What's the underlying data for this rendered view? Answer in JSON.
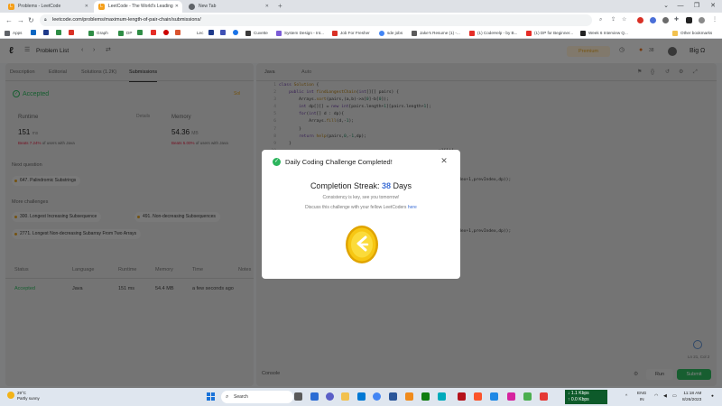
{
  "browser": {
    "tabs": [
      {
        "title": "Problems - LeetCode",
        "active": false
      },
      {
        "title": "LeetCode - The World's Leading",
        "active": true
      },
      {
        "title": "New Tab",
        "active": false
      }
    ],
    "url": "leetcode.com/problems/maximum-length-of-pair-chain/submissions/",
    "bookmarks": [
      "Apps",
      "Graph",
      "DP",
      "Lec",
      "Cuvette",
      "System Design - Int...",
      "Job For Fresher",
      "sde jobs",
      "Jake's Resume (1) -...",
      "(1) CodeHelp - by B...",
      "(1) DP for Beginner...",
      "Week 6 Interview Q...",
      "Other bookmarks"
    ]
  },
  "lc_header": {
    "problem_list": "Problem List",
    "premium": "Premium",
    "streak_count": "38",
    "username": "Big Ω"
  },
  "left": {
    "tabs": [
      "Description",
      "Editorial",
      "Solutions (1.2K)",
      "Submissions"
    ],
    "status": "Accepted",
    "solution_btn": "Sol",
    "runtime_label": "Runtime",
    "runtime_value": "151",
    "runtime_unit": "ms",
    "runtime_beats_pct": "Beats 7.24%",
    "runtime_beats_rest": "of users with Java",
    "details": "Details",
    "memory_label": "Memory",
    "memory_value": "54.36",
    "memory_unit": "MB",
    "memory_beats_pct": "Beats 5.00%",
    "memory_beats_rest": "of users with Java",
    "next_question_label": "Next question",
    "next_question": "647. Palindromic Substrings",
    "more_challenges_label": "More challenges",
    "challenges": [
      "300. Longest Increasing Subsequence",
      "491. Non-decreasing Subsequences",
      "2771. Longest Non-decreasing Subarray From Two Arrays"
    ],
    "table_headers": [
      "Status",
      "Language",
      "Runtime",
      "Memory",
      "Time",
      "Notes"
    ],
    "row": {
      "status": "Accepted",
      "language": "Java",
      "runtime": "151 ms",
      "memory": "54.4 MB",
      "time": "a few seconds ago"
    }
  },
  "editor": {
    "language": "Java",
    "auto": "Auto",
    "line_numbers": [
      "1",
      "2",
      "3",
      "4",
      "5",
      "6",
      "7",
      "8",
      "9",
      "10",
      "11",
      "12",
      "13",
      "14",
      "15",
      "16",
      "17",
      "18",
      "19",
      "20",
      "21"
    ],
    "console": "Console",
    "run": "Run",
    "submit": "Submit",
    "cursor": "Ln 21, Col 2"
  },
  "modal": {
    "title": "Daily Coding Challenge Completed!",
    "streak_prefix": "Completion Streak:",
    "streak_days": "38",
    "streak_suffix": "Days",
    "note1": "Consistency is key, see you tomorrow!",
    "note2": "Discuss this challenge with your fellow LeetCoders",
    "note2_link": "here"
  },
  "taskbar": {
    "temp": "29°C",
    "weather": "Partly sunny",
    "search": "Search",
    "net_down": "↓ 1.1 Kbps",
    "net_up": "↑ 0.0 Kbps",
    "lang": "ENG",
    "lang2": "IN",
    "time": "11:18 AM",
    "date": "8/26/2023"
  }
}
